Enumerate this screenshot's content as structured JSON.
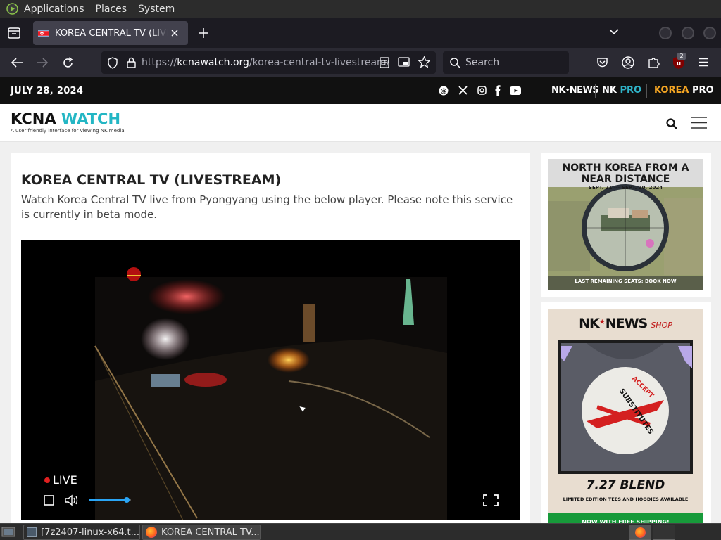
{
  "os_panel": {
    "menus": [
      "Applications",
      "Places",
      "System"
    ]
  },
  "browser": {
    "tab_title": "KOREA CENTRAL TV (LIVESTREAM)",
    "url_protocol": "https://",
    "url_host": "kcnawatch.org",
    "url_path": "/korea-central-tv-livestream/",
    "search_placeholder": "Search",
    "extension_badge": "2"
  },
  "site": {
    "date": "JULY 28, 2024",
    "brands": [
      "NK",
      "NEWS",
      "NK",
      "PRO",
      "KOREA",
      "PRO"
    ],
    "logo_part1": "KCNA",
    "logo_part2": "WATCH",
    "tagline": "A user friendly interface for viewing NK media",
    "article_title": "KOREA CENTRAL TV (LIVESTREAM)",
    "article_desc": "Watch Korea Central TV live from Pyongyang using the below player. Please note this service is currently in beta mode.",
    "live_label": "LIVE",
    "volume_level": 0.9
  },
  "ads": {
    "ad1_title_line1": "NORTH KOREA FROM A",
    "ad1_title_line2": "NEAR DISTANCE",
    "ad1_dates": "SEPT. 21 --- SEPT. 30, 2024",
    "ad1_cta": "LAST REMAINING SEATS: BOOK NOW",
    "ad2_brand1": "NK",
    "ad2_brand2": "NEWS",
    "ad2_shop": "SHOP",
    "ad2_circle_line1": "ACCEPT",
    "ad2_circle_line2": "SUBSTITUTES",
    "ad2_product": "7.27 BLEND",
    "ad2_subtitle": "LIMITED EDITION TEES AND HOODIES AVAILABLE",
    "ad2_banner": "NOW WITH FREE SHIPPING!"
  },
  "taskbar": {
    "task1": "[7z2407-linux-x64.t...",
    "task2": "KOREA CENTRAL TV..."
  },
  "colors": {
    "accent_teal": "#23b6c4",
    "korea_pro_orange": "#f5a623",
    "nk_pro_teal": "#2fb3c7",
    "live_red": "#e02020",
    "volume_blue": "#2aa5f5"
  }
}
